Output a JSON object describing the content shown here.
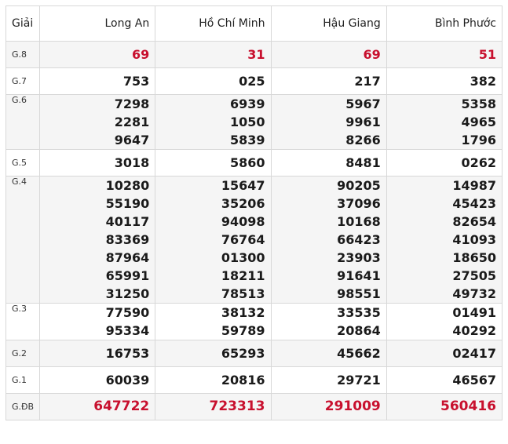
{
  "header": {
    "label": "Giải",
    "provinces": [
      "Long An",
      "Hồ Chí Minh",
      "Hậu Giang",
      "Bình Phước"
    ]
  },
  "prizes": [
    {
      "id": "g8",
      "label": "G.8",
      "red": true,
      "values": [
        [
          "69"
        ],
        [
          "31"
        ],
        [
          "69"
        ],
        [
          "51"
        ]
      ]
    },
    {
      "id": "g7",
      "label": "G.7",
      "red": false,
      "values": [
        [
          "753"
        ],
        [
          "025"
        ],
        [
          "217"
        ],
        [
          "382"
        ]
      ]
    },
    {
      "id": "g6",
      "label": "G.6",
      "red": false,
      "values": [
        [
          "7298",
          "2281",
          "9647"
        ],
        [
          "6939",
          "1050",
          "5839"
        ],
        [
          "5967",
          "9961",
          "8266"
        ],
        [
          "5358",
          "4965",
          "1796"
        ]
      ]
    },
    {
      "id": "g5",
      "label": "G.5",
      "red": false,
      "values": [
        [
          "3018"
        ],
        [
          "5860"
        ],
        [
          "8481"
        ],
        [
          "0262"
        ]
      ]
    },
    {
      "id": "g4",
      "label": "G.4",
      "red": false,
      "values": [
        [
          "10280",
          "55190",
          "40117",
          "83369",
          "87964",
          "65991",
          "31250"
        ],
        [
          "15647",
          "35206",
          "94098",
          "76764",
          "01300",
          "18211",
          "78513"
        ],
        [
          "90205",
          "37096",
          "10168",
          "66423",
          "23903",
          "91641",
          "98551"
        ],
        [
          "14987",
          "45423",
          "82654",
          "41093",
          "18650",
          "27505",
          "49732"
        ]
      ]
    },
    {
      "id": "g3",
      "label": "G.3",
      "red": false,
      "values": [
        [
          "77590",
          "95334"
        ],
        [
          "38132",
          "59789"
        ],
        [
          "33535",
          "20864"
        ],
        [
          "01491",
          "40292"
        ]
      ]
    },
    {
      "id": "g2",
      "label": "G.2",
      "red": false,
      "values": [
        [
          "16753"
        ],
        [
          "65293"
        ],
        [
          "45662"
        ],
        [
          "02417"
        ]
      ]
    },
    {
      "id": "g1",
      "label": "G.1",
      "red": false,
      "values": [
        [
          "60039"
        ],
        [
          "20816"
        ],
        [
          "29721"
        ],
        [
          "46567"
        ]
      ]
    },
    {
      "id": "gdb",
      "label": "G.ĐB",
      "red": true,
      "values": [
        [
          "647722"
        ],
        [
          "723313"
        ],
        [
          "291009"
        ],
        [
          "560416"
        ]
      ]
    }
  ],
  "colors": {
    "accent_red": "#c8102e",
    "border": "#d8d8d8",
    "alt_row": "#f5f5f5"
  }
}
